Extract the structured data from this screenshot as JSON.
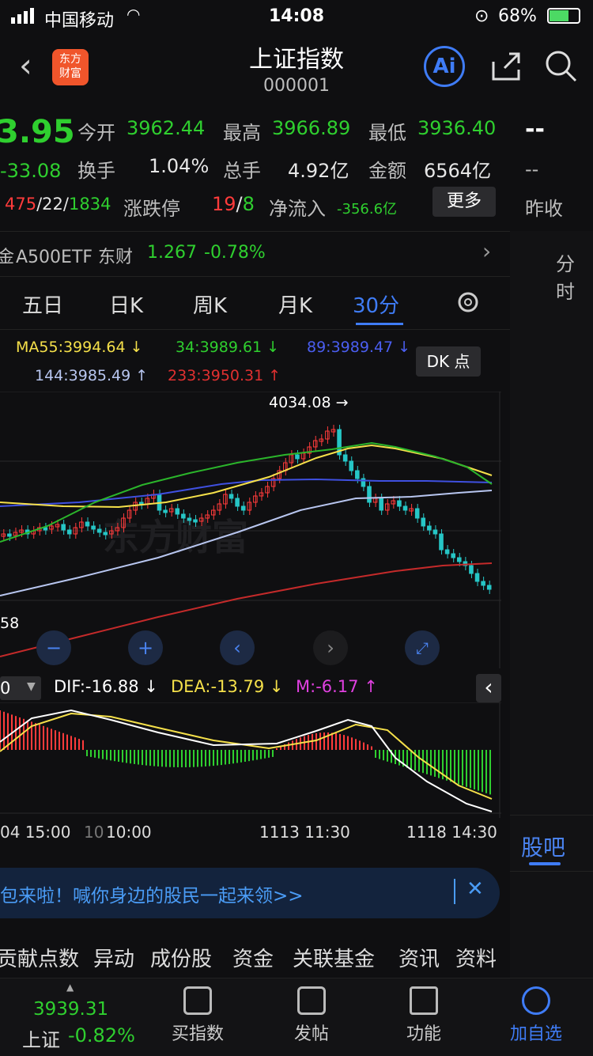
{
  "status": {
    "carrier": "中国移动",
    "time": "14:08",
    "battery": "68%"
  },
  "header": {
    "title": "上证指数",
    "code": "000001",
    "logo_line1": "东方",
    "logo_line2": "财富",
    "ai_label": "Ai"
  },
  "quote": {
    "price": "3.95",
    "change": "-33.08",
    "open_label": "今开",
    "open": "3962.44",
    "high_label": "最高",
    "high": "3966.89",
    "low_label": "最低",
    "low": "3936.40",
    "turnover_label": "换手",
    "turnover": "1.04%",
    "volume_label": "总手",
    "volume": "4.92亿",
    "amount_label": "金额",
    "amount": "6564亿",
    "breadth_up": "475",
    "breadth_flat": "22",
    "breadth_down": "1834",
    "limit_label": "涨跌停",
    "limit_up": "19",
    "limit_down": "8",
    "netflow_label": "净流入",
    "netflow": "-356.6亿",
    "more": "更多",
    "right_dash": "--",
    "right_dash2": "--",
    "prev_close_label": "昨收"
  },
  "etf": {
    "prefix": "金",
    "name": "A500ETF 东财",
    "price": "1.267",
    "change": "-0.78%"
  },
  "right": {
    "intraday": "分时",
    "guba": "股吧"
  },
  "tabs": [
    "五日",
    "日K",
    "周K",
    "月K",
    "30分"
  ],
  "ma": {
    "ma55": "MA55:3994.64 ↓",
    "ma34": "34:3989.61 ↓",
    "ma89": "89:3989.47 ↓",
    "ma144": "144:3985.49 ↑",
    "ma233": "233:3950.31 ↑",
    "dk": "DK 点"
  },
  "chart": {
    "peak_label": "4034.08",
    "low_label": "58",
    "watermark": "东方财富"
  },
  "macd": {
    "dif": "DIF:-16.88 ↓",
    "dea": "DEA:-13.79 ↓",
    "m": "M:-6.17 ↑",
    "param": "0"
  },
  "axis": {
    "a": "04 15:00",
    "b": "10:00",
    "c": "1113 11:30",
    "d": "1118 14:30"
  },
  "promo": {
    "text": "包来啦！喊你身边的股民一起来领>>"
  },
  "bottom_tabs": [
    "贡献点数",
    "异动",
    "成份股",
    "资金",
    "关联基金",
    "资讯",
    "资料"
  ],
  "nav": {
    "index_price": "3939.31",
    "index_name": "上证",
    "index_change": "-0.82%",
    "buy": "买指数",
    "post": "发帖",
    "func": "功能",
    "add": "加自选"
  },
  "colors": {
    "up": "#ff3b3b",
    "down": "#2fcf2f",
    "accent": "#3f7cf6"
  }
}
